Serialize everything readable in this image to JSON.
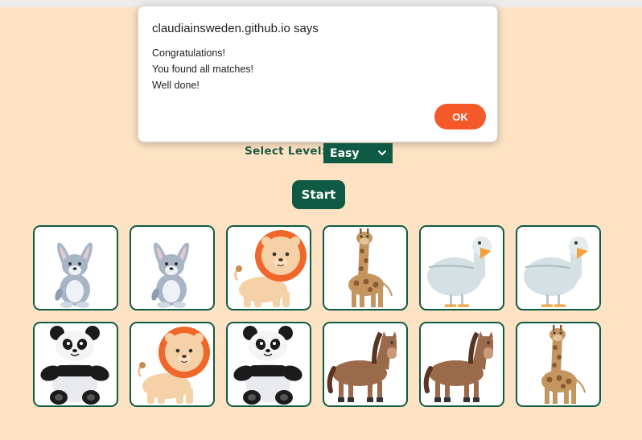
{
  "dialog": {
    "origin": "claudiainsweden.github.io says",
    "lines": [
      "Congratulations!",
      "You found all matches!",
      "Well done!"
    ],
    "ok_label": "OK"
  },
  "controls": {
    "level_label": "Select Level:",
    "level_value": "Easy",
    "start_label": "Start"
  },
  "colors": {
    "background": "#fde3c4",
    "primary": "#0f5a43",
    "ok_button": "#f5592a"
  },
  "cards": [
    {
      "animal": "rabbit-icon"
    },
    {
      "animal": "rabbit-icon"
    },
    {
      "animal": "lion-icon"
    },
    {
      "animal": "giraffe-icon"
    },
    {
      "animal": "goose-icon"
    },
    {
      "animal": "goose-icon"
    },
    {
      "animal": "panda-icon"
    },
    {
      "animal": "lion-icon"
    },
    {
      "animal": "panda-icon"
    },
    {
      "animal": "horse-icon"
    },
    {
      "animal": "horse-icon"
    },
    {
      "animal": "giraffe-icon"
    }
  ]
}
